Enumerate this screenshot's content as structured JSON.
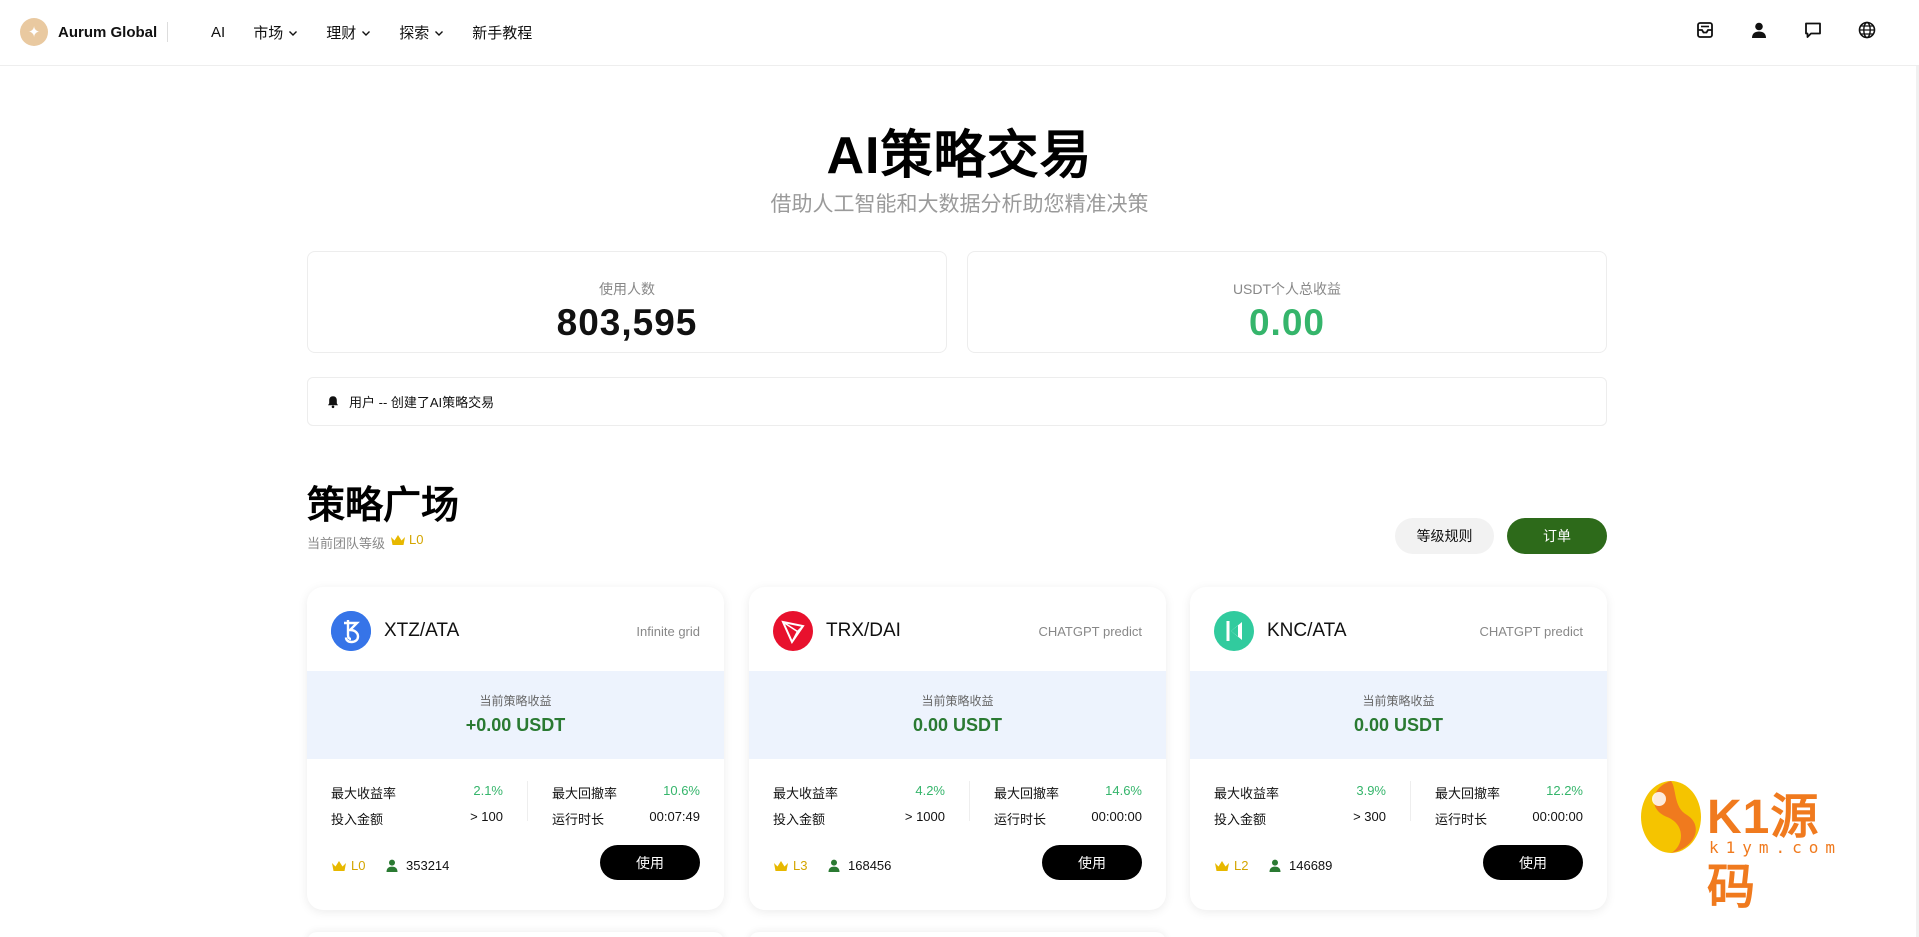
{
  "brand": {
    "name": "Aurum Global",
    "logo_icon": "sparkle-icon"
  },
  "nav": {
    "items": [
      {
        "label": "AI",
        "dropdown": false
      },
      {
        "label": "市场",
        "dropdown": true
      },
      {
        "label": "理财",
        "dropdown": true
      },
      {
        "label": "探索",
        "dropdown": true
      },
      {
        "label": "新手教程",
        "dropdown": false
      }
    ],
    "icons": [
      "inbox-icon",
      "user-icon",
      "chat-icon",
      "globe-icon"
    ]
  },
  "hero": {
    "title": "AI策略交易",
    "subtitle": "借助人工智能和大数据分析助您精准决策"
  },
  "stats": {
    "users_label": "使用人数",
    "users_value": "803,595",
    "profit_label": "USDT个人总收益",
    "profit_value": "0.00"
  },
  "notice": {
    "text": "用户 -- 创建了AI策略交易"
  },
  "square": {
    "title": "策略广场",
    "team_level_label": "当前团队等级",
    "team_level": "L0",
    "rules_button": "等级规则",
    "orders_button": "订单"
  },
  "cards": [
    {
      "pair": "XTZ/ATA",
      "coin_icon": "tezos-icon",
      "type": "Infinite grid",
      "profit_label": "当前策略收益",
      "profit_value": "+0.00 USDT",
      "max_return_label": "最大收益率",
      "max_return": "2.1%",
      "max_drawdown_label": "最大回撤率",
      "max_drawdown": "10.6%",
      "invest_label": "投入金额",
      "invest": "> 100",
      "runtime_label": "运行时长",
      "runtime": "00:07:49",
      "level": "L0",
      "users": "353214",
      "use_button": "使用"
    },
    {
      "pair": "TRX/DAI",
      "coin_icon": "tron-icon",
      "type": "CHATGPT predict",
      "profit_label": "当前策略收益",
      "profit_value": "0.00 USDT",
      "max_return_label": "最大收益率",
      "max_return": "4.2%",
      "max_drawdown_label": "最大回撤率",
      "max_drawdown": "14.6%",
      "invest_label": "投入金额",
      "invest": "> 1000",
      "runtime_label": "运行时长",
      "runtime": "00:00:00",
      "level": "L3",
      "users": "168456",
      "use_button": "使用"
    },
    {
      "pair": "KNC/ATA",
      "coin_icon": "kyber-icon",
      "type": "CHATGPT predict",
      "profit_label": "当前策略收益",
      "profit_value": "0.00 USDT",
      "max_return_label": "最大收益率",
      "max_return": "3.9%",
      "max_drawdown_label": "最大回撤率",
      "max_drawdown": "12.2%",
      "invest_label": "投入金额",
      "invest": "> 300",
      "runtime_label": "运行时长",
      "runtime": "00:00:00",
      "level": "L2",
      "users": "146689",
      "use_button": "使用"
    }
  ],
  "watermark": {
    "title": "K1源码",
    "sub": "k1ym.com"
  },
  "colors": {
    "accent_green": "#35b56b",
    "profit_green": "#2a7a32",
    "orders_button": "#2d6a1a",
    "level_gold": "#d4a500",
    "profit_bg": "#edf3fd"
  }
}
